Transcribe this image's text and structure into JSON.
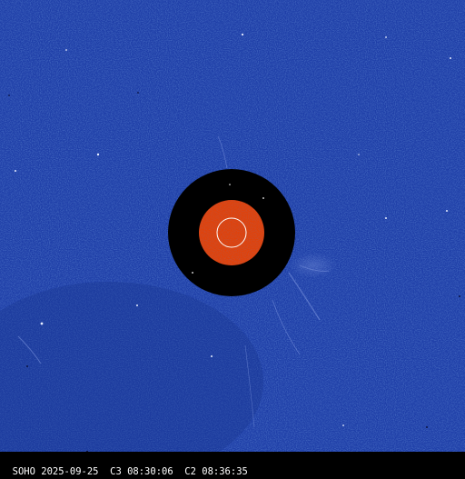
{
  "image": {
    "caption": "SOHO 2025-09-25  C3 08:30:06  C2 08:36:35",
    "colors": {
      "sky": "#1f3fa8",
      "sky_dark": "#1a3690",
      "occulter": "#000000",
      "sun_disk": "#e0420a",
      "sun_outline": "#ffffff",
      "caption_text": "#ffffff",
      "caption_background": "#000000"
    }
  }
}
